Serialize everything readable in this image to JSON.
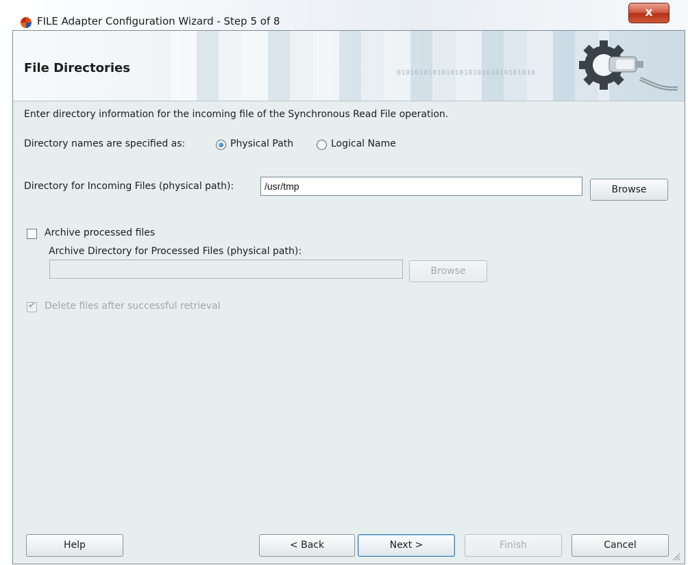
{
  "window": {
    "title": "FILE Adapter Configuration Wizard - Step 5 of 8",
    "close_glyph": "x"
  },
  "header": {
    "title": "File Directories",
    "binary_text": "0101010101010101010101010101010"
  },
  "content": {
    "intro": "Enter directory information for the incoming file of the Synchronous Read File operation.",
    "directory_names_label": "Directory names are specified as:",
    "radio_physical": {
      "label": "Physical Path",
      "selected": true
    },
    "radio_logical": {
      "label": "Logical Name",
      "selected": false
    },
    "incoming_dir_label": "Directory for Incoming Files (physical path):",
    "incoming_dir_value": "/usr/tmp",
    "browse_label": "Browse",
    "archive_checkbox": {
      "label": "Archive processed files",
      "checked": false
    },
    "archive_dir_label": "Archive Directory for Processed Files (physical path):",
    "archive_dir_value": "",
    "archive_browse_label": "Browse",
    "delete_checkbox": {
      "label": "Delete files after successful retrieval",
      "checked": true,
      "enabled": false
    }
  },
  "footer": {
    "help": "Help",
    "back": "< Back",
    "next": "Next >",
    "finish": "Finish",
    "cancel": "Cancel"
  },
  "icons": [
    "app-logo-icon",
    "close-icon",
    "gear-plug-icon",
    "resize-grip-icon"
  ],
  "colors": {
    "accent": "#1e5f9e",
    "panel": "#e7eeee",
    "close": "#c64127"
  }
}
